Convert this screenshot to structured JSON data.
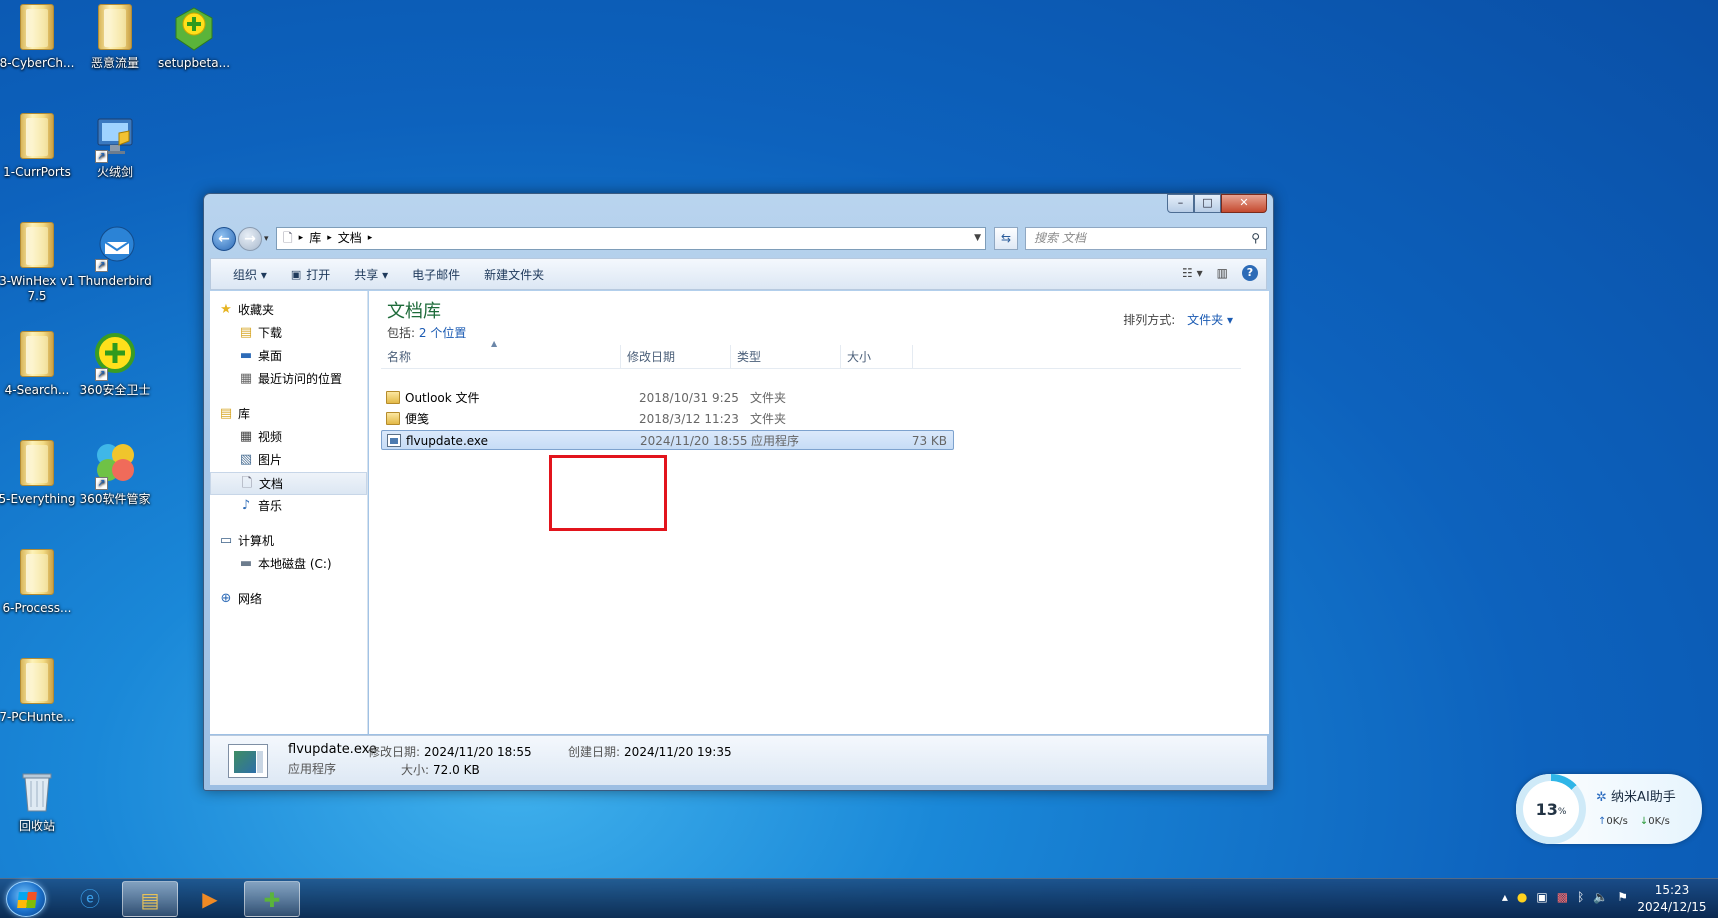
{
  "desktop": {
    "icons": [
      {
        "label": "8-CyberCh...",
        "type": "folder"
      },
      {
        "label": "恶意流量",
        "type": "folder"
      },
      {
        "label": "setupbeta...",
        "type": "360"
      },
      {
        "label": "1-CurrPorts",
        "type": "folder"
      },
      {
        "label": "火绒剑",
        "type": "app"
      },
      {
        "label": "3-WinHex v17.5",
        "type": "folder"
      },
      {
        "label": "Thunderbird",
        "type": "app"
      },
      {
        "label": "4-Search...",
        "type": "folder"
      },
      {
        "label": "360安全卫士",
        "type": "360"
      },
      {
        "label": "5-Everything",
        "type": "folder"
      },
      {
        "label": "360软件管家",
        "type": "app"
      },
      {
        "label": "6-Process...",
        "type": "folder"
      },
      {
        "label": "7-PCHunte...",
        "type": "folder"
      },
      {
        "label": "回收站",
        "type": "recycle"
      }
    ]
  },
  "window": {
    "controls": {
      "min": "–",
      "max": "□",
      "close": "✕"
    },
    "breadcrumb": [
      "库",
      "文档"
    ],
    "search_placeholder": "搜索 文档",
    "toolbar": {
      "organize": "组织 ▾",
      "open": "打开",
      "share": "共享 ▾",
      "email": "电子邮件",
      "new_folder": "新建文件夹"
    },
    "nav": {
      "favorites": "收藏夹",
      "downloads": "下载",
      "desktop": "桌面",
      "recent": "最近访问的位置",
      "libraries": "库",
      "videos": "视频",
      "pictures": "图片",
      "documents": "文档",
      "music": "音乐",
      "computer": "计算机",
      "local_disk": "本地磁盘 (C:)",
      "network": "网络"
    },
    "library": {
      "title": "文档库",
      "includes_label": "包括:",
      "includes_link": "2 个位置",
      "sort_label": "排列方式:",
      "sort_value": "文件夹 ▾"
    },
    "columns": {
      "name": "名称",
      "modified": "修改日期",
      "type": "类型",
      "size": "大小"
    },
    "files": [
      {
        "name": "Outlook 文件",
        "modified": "2018/10/31 9:25",
        "type": "文件夹",
        "size": ""
      },
      {
        "name": "便笺",
        "modified": "2018/3/12 11:23",
        "type": "文件夹",
        "size": ""
      },
      {
        "name": "flvupdate.exe",
        "modified": "2024/11/20 18:55",
        "type": "应用程序",
        "size": "73 KB"
      }
    ],
    "details": {
      "filename": "flvupdate.exe",
      "filetype": "应用程序",
      "modified_label": "修改日期:",
      "modified_value": "2024/11/20 18:55",
      "created_label": "创建日期:",
      "created_value": "2024/11/20 19:35",
      "size_label": "大小:",
      "size_value": "72.0 KB"
    }
  },
  "ai_widget": {
    "percent": "13",
    "percent_unit": "%",
    "name": "纳米AI助手",
    "upload": "0K/s",
    "download": "0K/s"
  },
  "taskbar": {
    "time": "15:23",
    "date": "2024/12/15"
  }
}
